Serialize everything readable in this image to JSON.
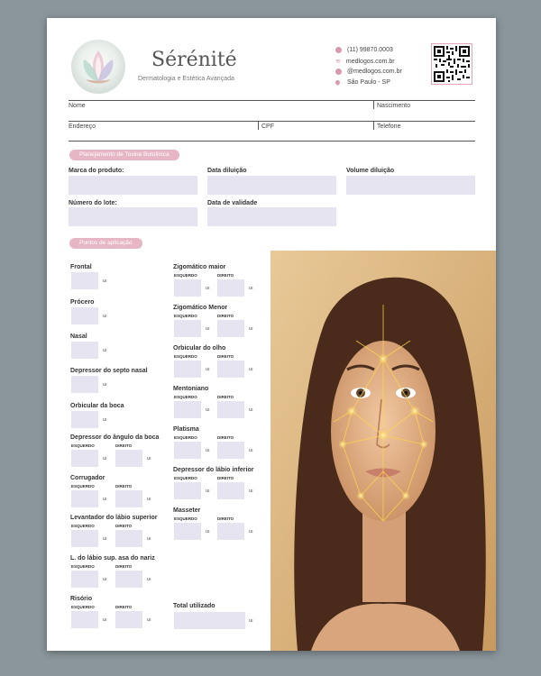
{
  "brand": {
    "name": "Sérénité",
    "tagline": "Dermatologia e Estética Avançada"
  },
  "contact": {
    "phone": "(11) 99870.0003",
    "website": "medlogos.com.br",
    "email": "@medlogos.com.br",
    "location": "São Paulo - SP"
  },
  "icons": {
    "phone": "phone-icon",
    "website": "wifi-icon",
    "email": "at-icon",
    "location": "pin-icon"
  },
  "patient": {
    "name_label": "Nome",
    "birth_label": "Nascimento",
    "address_label": "Endereço",
    "cpf_label": "CPF",
    "phone_label": "Telefone"
  },
  "planning": {
    "title": "Planejamento de Toxina Botulínica",
    "product_label": "Marca do produto:",
    "dilution_date_label": "Data diluição",
    "dilution_volume_label": "Volume diluição",
    "lot_label": "Número do lote:",
    "expiry_label": "Data de validade"
  },
  "points": {
    "title": "Pontos de aplicação",
    "left_label": "ESQUERDO",
    "right_label": "DIREITO",
    "unit": "UI",
    "frontal": "Frontal",
    "procero": "Prócero",
    "nasal": "Nasal",
    "septo": "Depressor do septo nasal",
    "orbicular_boca": "Orbicular da boca",
    "angulo_boca": "Depressor do ângulo da boca",
    "corrugador": "Corrugador",
    "levantador": "Levantador do lábio superior",
    "asa_nariz": "L. do lábio sup. asa do nariz",
    "risorio": "Risório",
    "zig_maior": "Zigomático maior",
    "zig_menor": "Zigomático Menor",
    "orbicular_olho": "Orbicular do olho",
    "mentoniano": "Mentoniano",
    "platisma": "Platisma",
    "labio_inferior": "Depressor do lábio inferior",
    "masseter": "Masseter",
    "total": "Total utilizado"
  },
  "colors": {
    "accent": "#e6b6c5",
    "field": "#e7e4f1"
  }
}
